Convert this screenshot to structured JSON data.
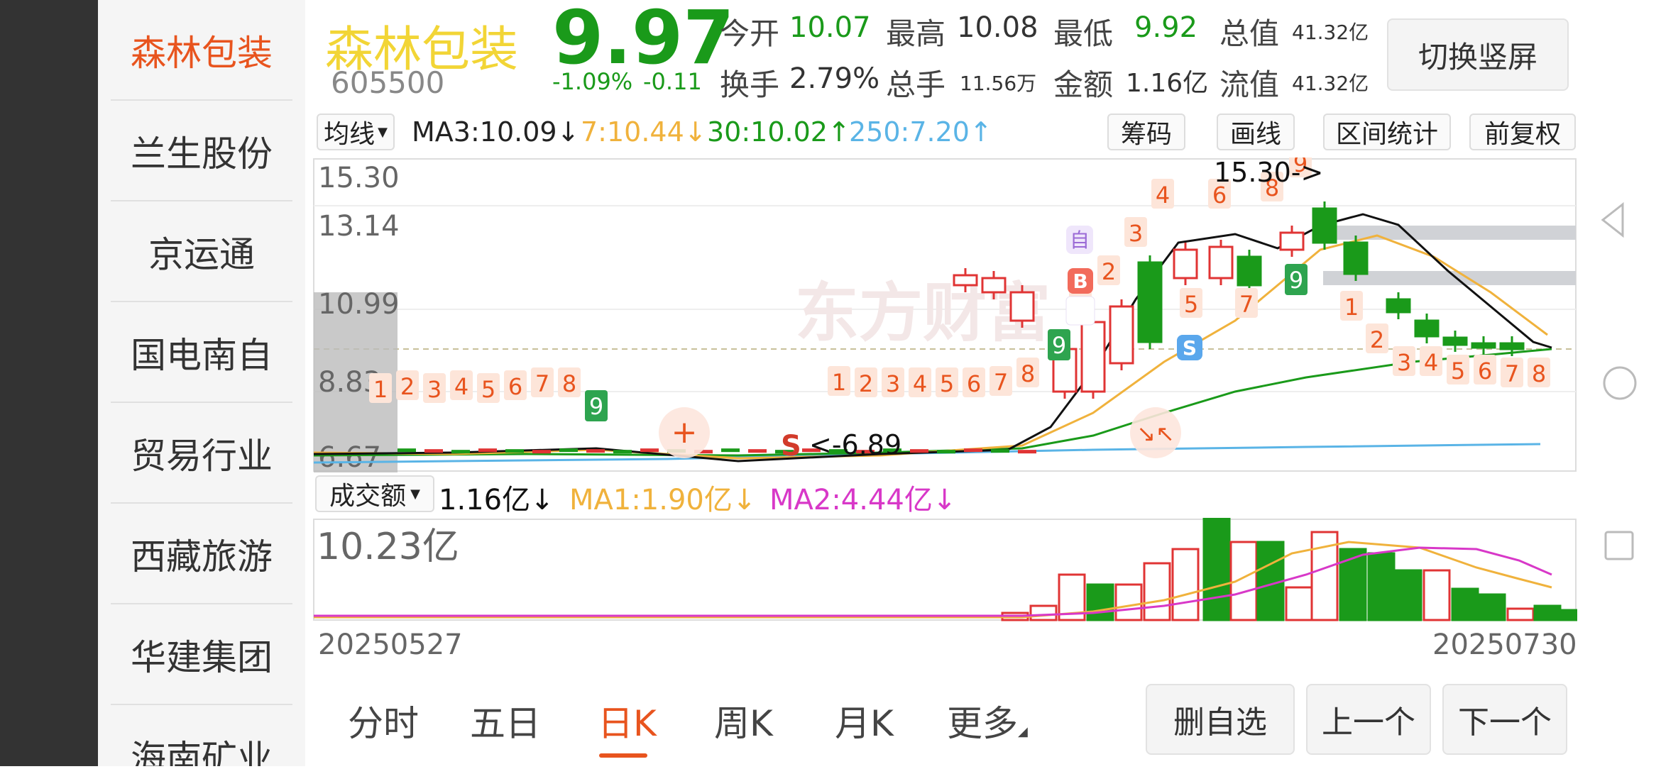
{
  "sidebar": {
    "items": [
      {
        "label": "森林包装"
      },
      {
        "label": "兰生股份"
      },
      {
        "label": "京运通"
      },
      {
        "label": "国电南自"
      },
      {
        "label": "贸易行业"
      },
      {
        "label": "西藏旅游"
      },
      {
        "label": "华建集团"
      },
      {
        "label": "海南矿业"
      }
    ]
  },
  "quote": {
    "name": "森林包装",
    "code": "605500",
    "price": "9.97",
    "change_pct": "-1.09%",
    "change": "-0.11",
    "open_label": "今开",
    "open": "10.07",
    "high_label": "最高",
    "high": "10.08",
    "low_label": "最低",
    "low": "9.92",
    "total_cap_label": "总值",
    "total_cap": "41.32亿",
    "turnover_label": "换手",
    "turnover": "2.79%",
    "volume_label": "总手",
    "volume": "11.56万",
    "amount_label": "金额",
    "amount": "1.16亿",
    "float_cap_label": "流值",
    "float_cap": "41.32亿",
    "switch_button": "切换竖屏"
  },
  "ma_bar": {
    "selector": "均线",
    "ma3": "MA3:10.09↓",
    "ma7": "7:10.44↓",
    "ma30": "30:10.02↑",
    "ma250": "250:7.20↑",
    "tools": [
      "筹码",
      "画线",
      "区间统计",
      "前复权"
    ]
  },
  "price_chart": {
    "y_labels": [
      "15.30",
      "13.14",
      "10.99",
      "8.83",
      "6.67"
    ],
    "high_marker": "15.30->",
    "low_marker": "<-6.89",
    "markers": {
      "self": "自",
      "buy": "B",
      "sell": "S",
      "sell_letter": "S"
    },
    "watermark": "东方财富"
  },
  "volume_bar": {
    "selector": "成交额",
    "value": "1.16亿↓",
    "ma1": "MA1:1.90亿↓",
    "ma2": "MA2:4.44亿↓",
    "max_label": "10.23亿"
  },
  "dates": {
    "start": "20250527",
    "end": "20250730"
  },
  "bottom": {
    "tabs": [
      "分时",
      "五日",
      "日K",
      "周K",
      "月K",
      "更多"
    ],
    "buttons": [
      "删自选",
      "上一个",
      "下一个"
    ]
  },
  "colors": {
    "up": "#e03434",
    "down": "#1a9a1a",
    "accent": "#e8541e",
    "ma7": "#f0b23c",
    "ma30": "#1a9a1a",
    "ma250": "#5ab4e6",
    "ma2": "#d838c8"
  }
}
